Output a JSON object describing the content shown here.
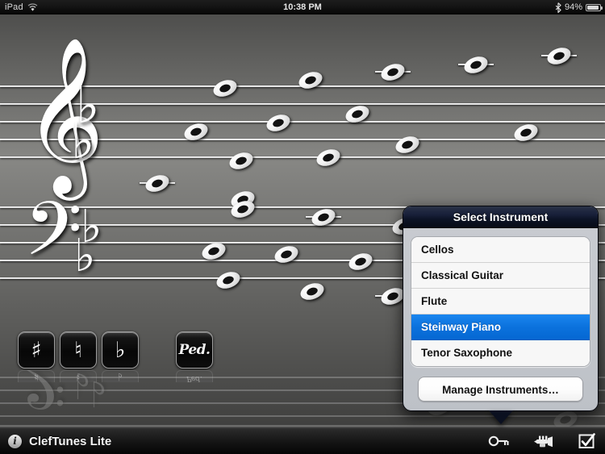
{
  "statusbar": {
    "carrier": "iPad",
    "wifi_icon": "wifi-icon",
    "time": "10:38 PM",
    "bluetooth_icon": "bluetooth-icon",
    "battery_percent": "94%",
    "battery_icon": "battery-icon"
  },
  "toolbar": {
    "info_icon": "info-icon",
    "info_glyph": "i",
    "app_title": "ClefTunes Lite",
    "icons": [
      {
        "name": "key-signature-icon",
        "label": "Key"
      },
      {
        "name": "instrument-trumpet-icon",
        "label": "Instrument"
      },
      {
        "name": "quiz-checklist-icon",
        "label": "Quiz"
      }
    ]
  },
  "accidentals": [
    {
      "name": "sharp-button",
      "glyph": "♯"
    },
    {
      "name": "natural-button",
      "glyph": "♮"
    },
    {
      "name": "flat-button",
      "glyph": "♭"
    },
    {
      "name": "pedal-button",
      "glyph": "Ped."
    }
  ],
  "staff": {
    "treble_clef": "𝄞",
    "bass_clef": "𝄢",
    "key_signature_accidental": "♭",
    "key_signature_count": 2,
    "treble_flat_glyph": "♭",
    "bass_flat_glyph": "♭",
    "note_glyph": "whole-note",
    "note_count": 24
  },
  "popover": {
    "title": "Select Instrument",
    "selected": "Steinway Piano",
    "items": [
      {
        "label": "Cellos",
        "selected": false
      },
      {
        "label": "Classical Guitar",
        "selected": false
      },
      {
        "label": "Flute",
        "selected": false
      },
      {
        "label": "Steinway Piano",
        "selected": true
      },
      {
        "label": "Tenor Saxophone",
        "selected": false
      }
    ],
    "manage_label": "Manage Instruments…",
    "accent_color": "#0b72dd",
    "header_color": "#0c1325"
  }
}
